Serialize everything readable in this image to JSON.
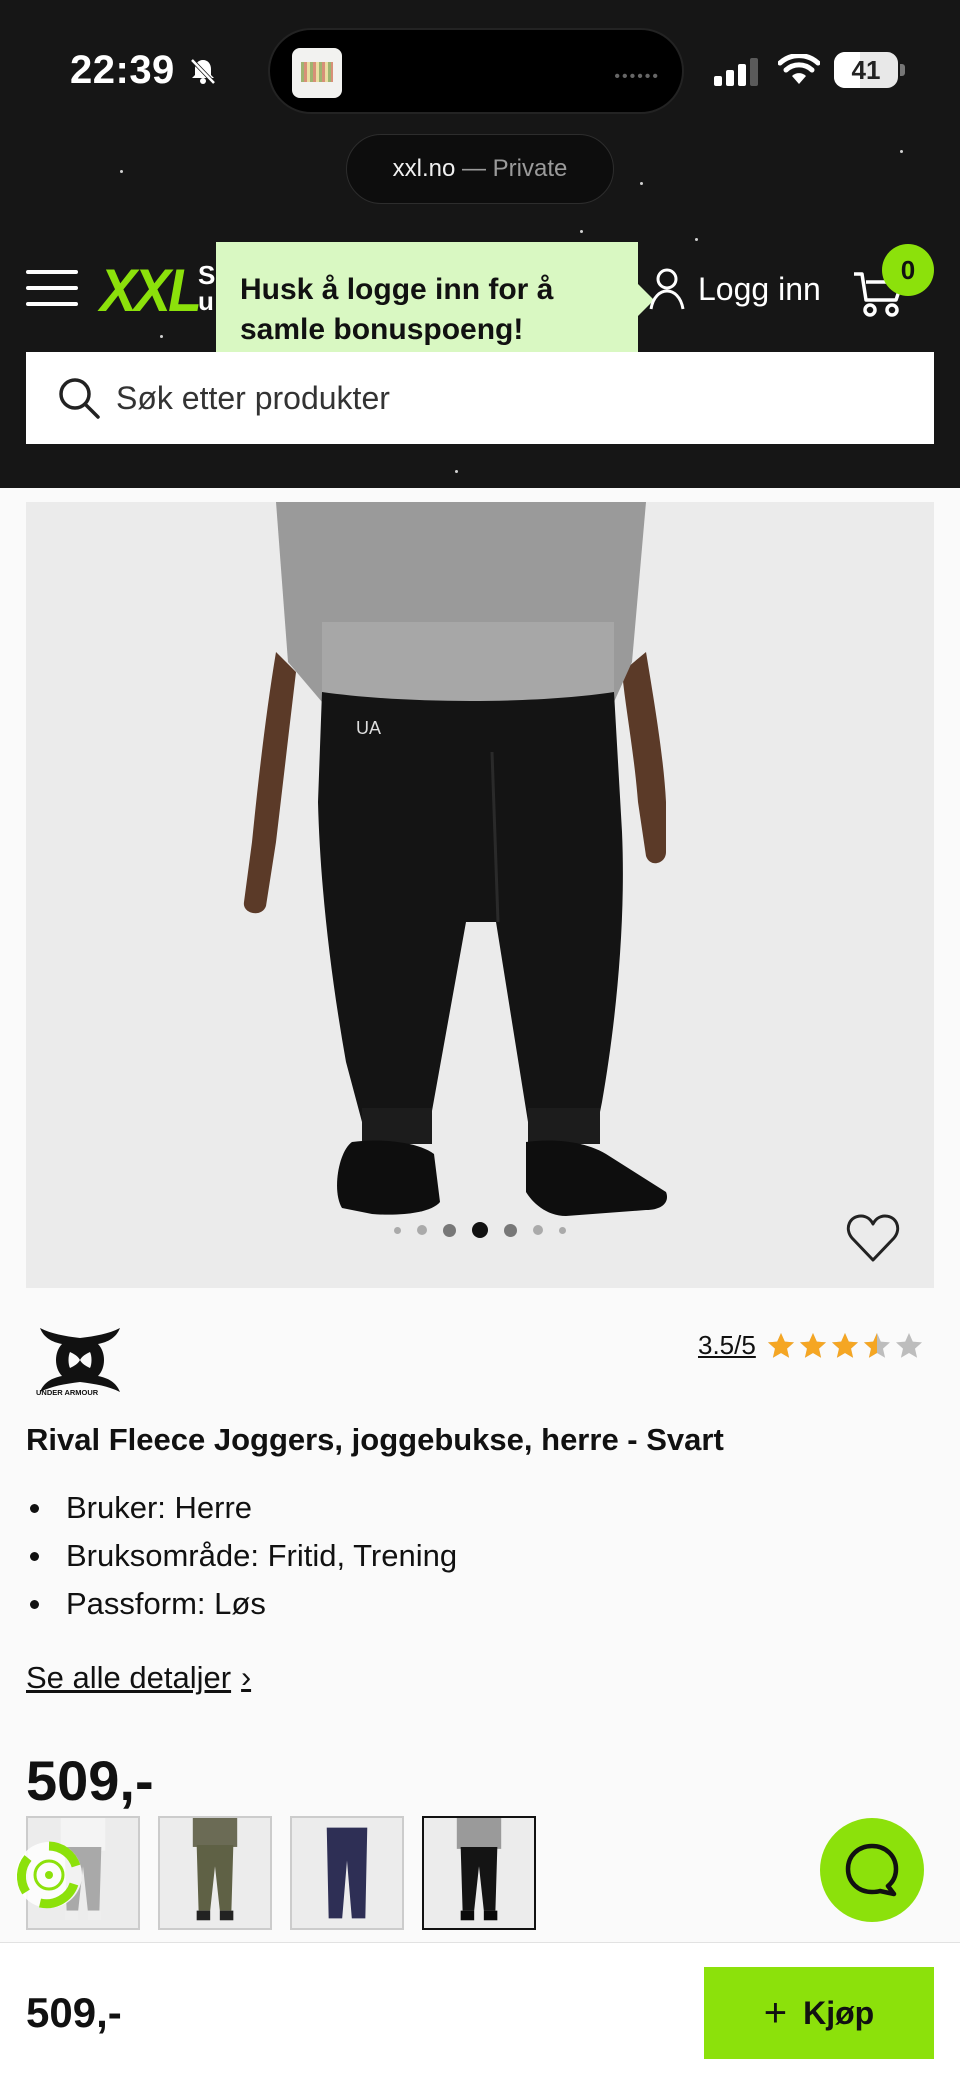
{
  "status_bar": {
    "time": "22:39",
    "battery": "41"
  },
  "browser": {
    "host": "xxl.no",
    "mode": " — Private"
  },
  "header": {
    "logo": "XXL",
    "logo_tag_partial": "S\nu",
    "tooltip": "Husk å logge inn for å samle bonuspoeng!",
    "login_label": "Logg inn",
    "cart_count": "0",
    "search_placeholder": "Søk etter produkter"
  },
  "product": {
    "brand": "UNDER ARMOUR",
    "rating_text": "3.5/5",
    "rating_value": 3.5,
    "rating_max": 5,
    "title": "Rival Fleece Joggers, joggebukse, herre - Svart",
    "features": [
      "Bruker: Herre",
      "Bruksområde: Fritid, Trening",
      "Passform: Løs"
    ],
    "details_link": "Se alle detaljer",
    "price": "509,-",
    "carousel": {
      "count": 7,
      "active_index": 3
    },
    "variants": [
      "grey",
      "olive",
      "navy",
      "black"
    ],
    "selected_variant": 3
  },
  "bottom_bar": {
    "price": "509,-",
    "buy_label": "Kjøp"
  },
  "colors": {
    "accent": "#8ce10b",
    "tooltip_bg": "#d9f8c2",
    "header_bg": "#161616",
    "star": "#f5a623"
  }
}
